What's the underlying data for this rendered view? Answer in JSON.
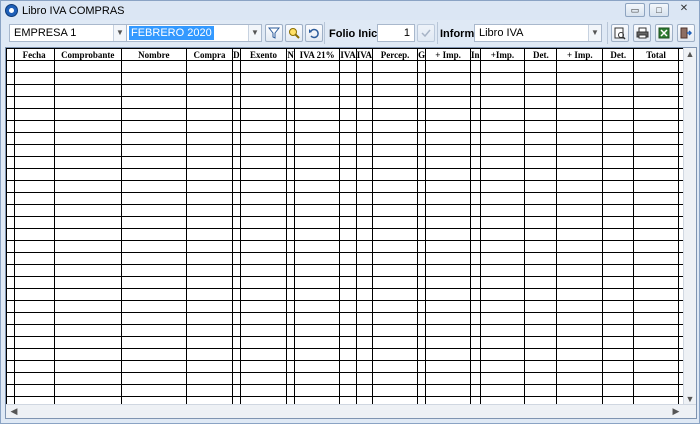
{
  "window": {
    "title": "Libro IVA COMPRAS",
    "controls": {
      "minimize": "▭",
      "maximize": "□",
      "close": "✕"
    }
  },
  "toolbar": {
    "empresa": "EMPRESA 1",
    "periodo": "FEBRERO 2020",
    "folio_label": "Folio Inicial",
    "folio_value": "1",
    "informe_label": "Informe",
    "informe_value": "Libro IVA",
    "icons": [
      "filter-icon",
      "search-icon",
      "undo-icon",
      "check-icon",
      "preview-icon",
      "print-icon",
      "excel-icon",
      "exit-icon"
    ]
  },
  "grid": {
    "columns": [
      "",
      "Fecha",
      "Comprobante",
      "Nombre",
      "Compra",
      "D",
      "Exento",
      "N",
      "IVA 21%",
      "IVA",
      "IVA",
      "Percep.",
      "G",
      "+ Imp.",
      "In",
      "+Imp.",
      "Det.",
      "+ Imp.",
      "Det.",
      "Total",
      ""
    ],
    "row_count": 29
  },
  "colors": {
    "selection": "#3399ff",
    "window_bg": "#dfe9f5",
    "grid_line": "#000000"
  }
}
